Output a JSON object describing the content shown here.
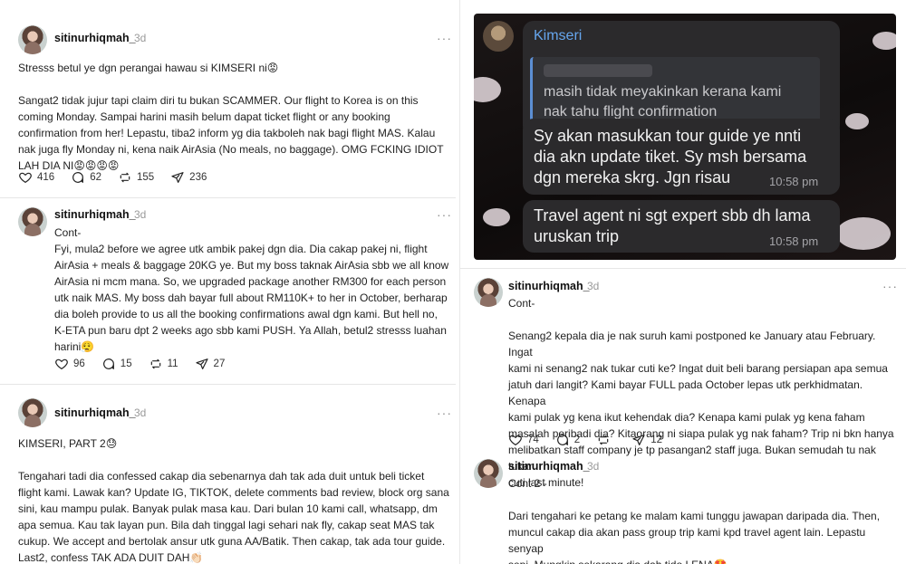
{
  "colors": {
    "username": "#111111",
    "timestamp": "#9a9a9a",
    "divider": "#e6e6e6",
    "chat_sender": "#66a6ee"
  },
  "posts": [
    {
      "username": "sitinurhiqmah_",
      "time": "3d",
      "more": "···",
      "text": "Stresss betul ye dgn perangai hawau si KIMSERI ni😡\n\nSangat2 tidak jujur tapi claim diri tu bukan SCAMMER. Our flight to Korea is on this\ncoming Monday. Sampai harini masih belum dapat ticket flight or any booking\nconfirmation from her! Lepastu, tiba2 inform yg dia takboleh nak bagi flight MAS. Kalau\nnak juga fly Monday ni, kena naik AirAsia (No meals, no baggage). OMG FCKING IDIOT\nLAH DIA NI😡😡😡😡",
      "likes": "416",
      "replies": "62",
      "reposts": "155",
      "shares": "236"
    },
    {
      "username": "sitinurhiqmah_",
      "time": "3d",
      "more": "···",
      "text": "Cont-\nFyi, mula2 before we agree utk ambik pakej dgn dia. Dia cakap pakej ni, flight\nAirAsia + meals & baggage 20KG ye. But my boss taknak AirAsia sbb we all know\nAirAsia ni mcm mana. So, we upgraded package another RM300 for each person\nutk naik MAS. My boss dah bayar full about RM110K+ to her in October, berharap\ndia boleh provide to us all the booking confirmations awal dgn kami. But hell no,\nK-ETA pun baru dpt 2 weeks ago sbb kami PUSH. Ya Allah, betul2 stresss luahan\nharini😮‍💨",
      "likes": "96",
      "replies": "15",
      "reposts": "11",
      "shares": "27"
    },
    {
      "username": "sitinurhiqmah_",
      "time": "3d",
      "more": "···",
      "text": "KIMSERI, PART 2😓\n\nTengahari tadi dia confessed cakap dia sebenarnya dah tak ada duit untuk beli ticket\nflight kami. Lawak kan? Update IG, TIKTOK, delete comments bad review, block org sana\nsini, kau mampu pulak. Banyak pulak masa kau. Dari bulan 10 kami call, whatsapp, dm\napa semua. Kau tak layan pun. Bila dah tinggal lagi sehari nak fly, cakap seat MAS tak\ncukup. We accept and bertolak ansur utk guna AA/Batik. Then cakap, tak ada tour guide.\nLast2, confess TAK ADA DUIT DAH👏🏻"
    },
    {
      "username": "sitinurhiqmah_",
      "time": "3d",
      "more": "···",
      "text": "Cont-\n\nSenang2 kepala dia je nak suruh kami postponed ke January atau February. Ingat\nkami ni senang2 nak tukar cuti ke? Ingat duit beli barang persiapan apa semua\njatuh dari langit? Kami bayar FULL pada October lepas utk perkhidmatan. Kenapa\nkami pulak yg kena ikut kehendak dia? Kenapa kami pulak yg kena faham\nmasalah peribadi dia? Kitaorang ni siapa pulak yg nak faham? Trip ni bkn hanya\nmelibatkan staff company je tp pasangan2 staff juga. Bukan semudah tu nak tukar\ncuti last minute!",
      "likes": "74",
      "replies": "2",
      "reposts": "",
      "shares": "12"
    },
    {
      "username": "sitinurhiqmah_",
      "time": "3d",
      "more": "···",
      "text": "Cont 2 -\n\nDari tengahari ke petang ke malam kami tunggu jawapan daripada dia. Then,\nmuncul cakap dia akan pass group trip kami kpd travel agent lain. Lepastu senyap\nsepi. Mungkin sekarang dia dah tido LENA🤩"
    }
  ],
  "chat": {
    "sender": "Kimseri",
    "quote": "masih tidak meyakinkan kerana kami\nnak tahu flight confirmation",
    "messages": [
      {
        "text": "Sy akan masukkan tour guide ye nnti\ndia akn update tiket. Sy msh bersama\ndgn mereka skrg. Jgn risau",
        "time": "10:58 pm"
      },
      {
        "text": "Travel agent ni sgt expert sbb dh lama\nuruskan trip",
        "time": "10:58 pm"
      }
    ]
  }
}
